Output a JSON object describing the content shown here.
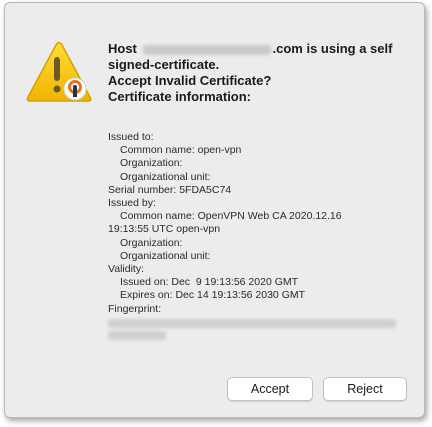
{
  "dialog": {
    "heading": {
      "host_prefix": "Host",
      "host_suffix": ".com is using a self signed-certificate.",
      "question": "Accept Invalid Certificate?",
      "info_title": "Certificate information:"
    },
    "icon": "warning-lock-icon",
    "details": {
      "issued_to_label": "Issued to:",
      "common_name_to": "Common name: open-vpn",
      "organization_to": "Organization:",
      "org_unit_to": "Organizational unit:",
      "serial": "Serial number: 5FDA5C74",
      "issued_by_label": "Issued by:",
      "common_name_by_1": "Common name: OpenVPN Web CA 2020.12.16",
      "common_name_by_2": "19:13:55 UTC open-vpn",
      "organization_by": "Organization:",
      "org_unit_by": "Organizational unit:",
      "validity_label": "Validity:",
      "issued_on": "Issued on: Dec  9 19:13:56 2020 GMT",
      "expires_on": "Expires on: Dec 14 19:13:56 2030 GMT",
      "fingerprint_label": "Fingerprint:"
    },
    "buttons": {
      "accept": "Accept",
      "reject": "Reject"
    }
  },
  "colors": {
    "dialog_bg": "#ececec",
    "warning_yellow": "#f5c400",
    "lock_orange": "#e8751a"
  }
}
